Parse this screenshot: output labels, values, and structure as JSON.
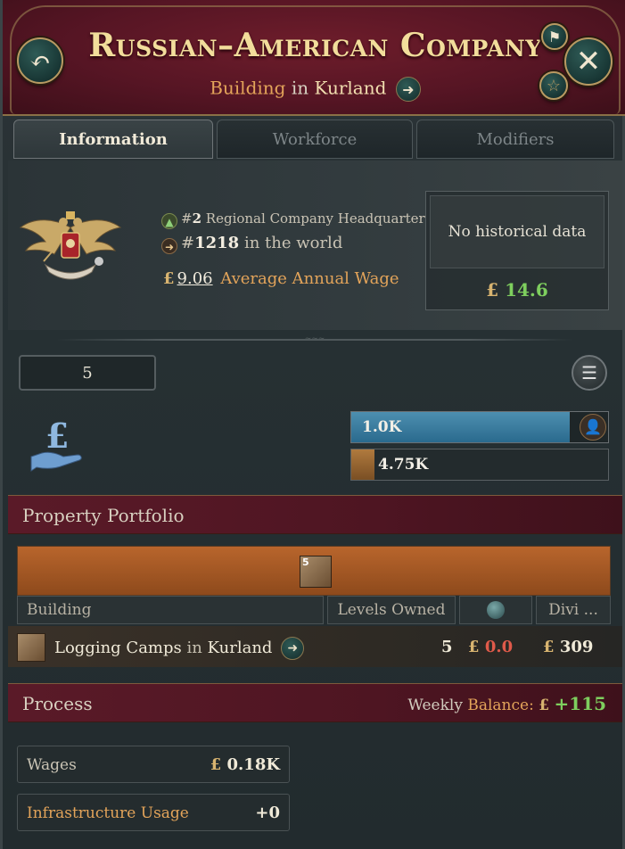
{
  "header": {
    "title": "Russian–American Company",
    "subtitle_type": "Building",
    "subtitle_in": "in",
    "subtitle_location": "Kurland",
    "back_icon": "undo-arrow-icon",
    "close_icon": "close-icon",
    "pin_icon": "signpost-icon",
    "star_icon": "star-icon"
  },
  "tabs": [
    {
      "label": "Information",
      "active": true
    },
    {
      "label": "Workforce",
      "active": false
    },
    {
      "label": "Modifiers",
      "active": false
    }
  ],
  "info": {
    "crest_icon": "double-headed-eagle-crest",
    "rank_regional_prefix": "#",
    "rank_regional_num": "2",
    "rank_regional_text": "Regional Company Headquarter",
    "rank_world_prefix": "#",
    "rank_world_num": "1218",
    "rank_world_text": "in the world",
    "wage_currency": "£",
    "wage_value": "9.06",
    "wage_label": "Average Annual Wage",
    "history_text": "No historical data",
    "history_currency": "£",
    "history_value": "14.6"
  },
  "levels": {
    "value": "5"
  },
  "finance": {
    "icon": "pound-hand-icon",
    "bar1_label": "1.0K",
    "bar1_fill_fraction": 0.85,
    "bar2_label": "4.75K"
  },
  "portfolio": {
    "title": "Property Portfolio",
    "icon_count": "5",
    "columns": [
      "Building",
      "Levels Owned",
      "",
      "Divi ..."
    ],
    "rows": [
      {
        "name": "Logging Camps",
        "in": "in",
        "location": "Kurland",
        "levels": "5",
        "productivity_currency": "£",
        "productivity": "0.0",
        "dividend_currency": "£",
        "dividend": "309"
      }
    ]
  },
  "process": {
    "title": "Process",
    "weekly_prefix": "Weekly",
    "weekly_label": "Balance:",
    "weekly_currency": "£",
    "weekly_value": "+115",
    "wages_label": "Wages",
    "wages_currency": "£",
    "wages_value": "0.18K",
    "infra_label": "Infrastructure Usage",
    "infra_value": "+0"
  },
  "colors": {
    "header_bg": "#561524",
    "title_gold": "#f2dd9b",
    "positive_green": "#7ecf5e",
    "negative_red": "#e05a4a",
    "accent_orange": "#e3a45a",
    "bar_blue": "#3a7fa2"
  }
}
